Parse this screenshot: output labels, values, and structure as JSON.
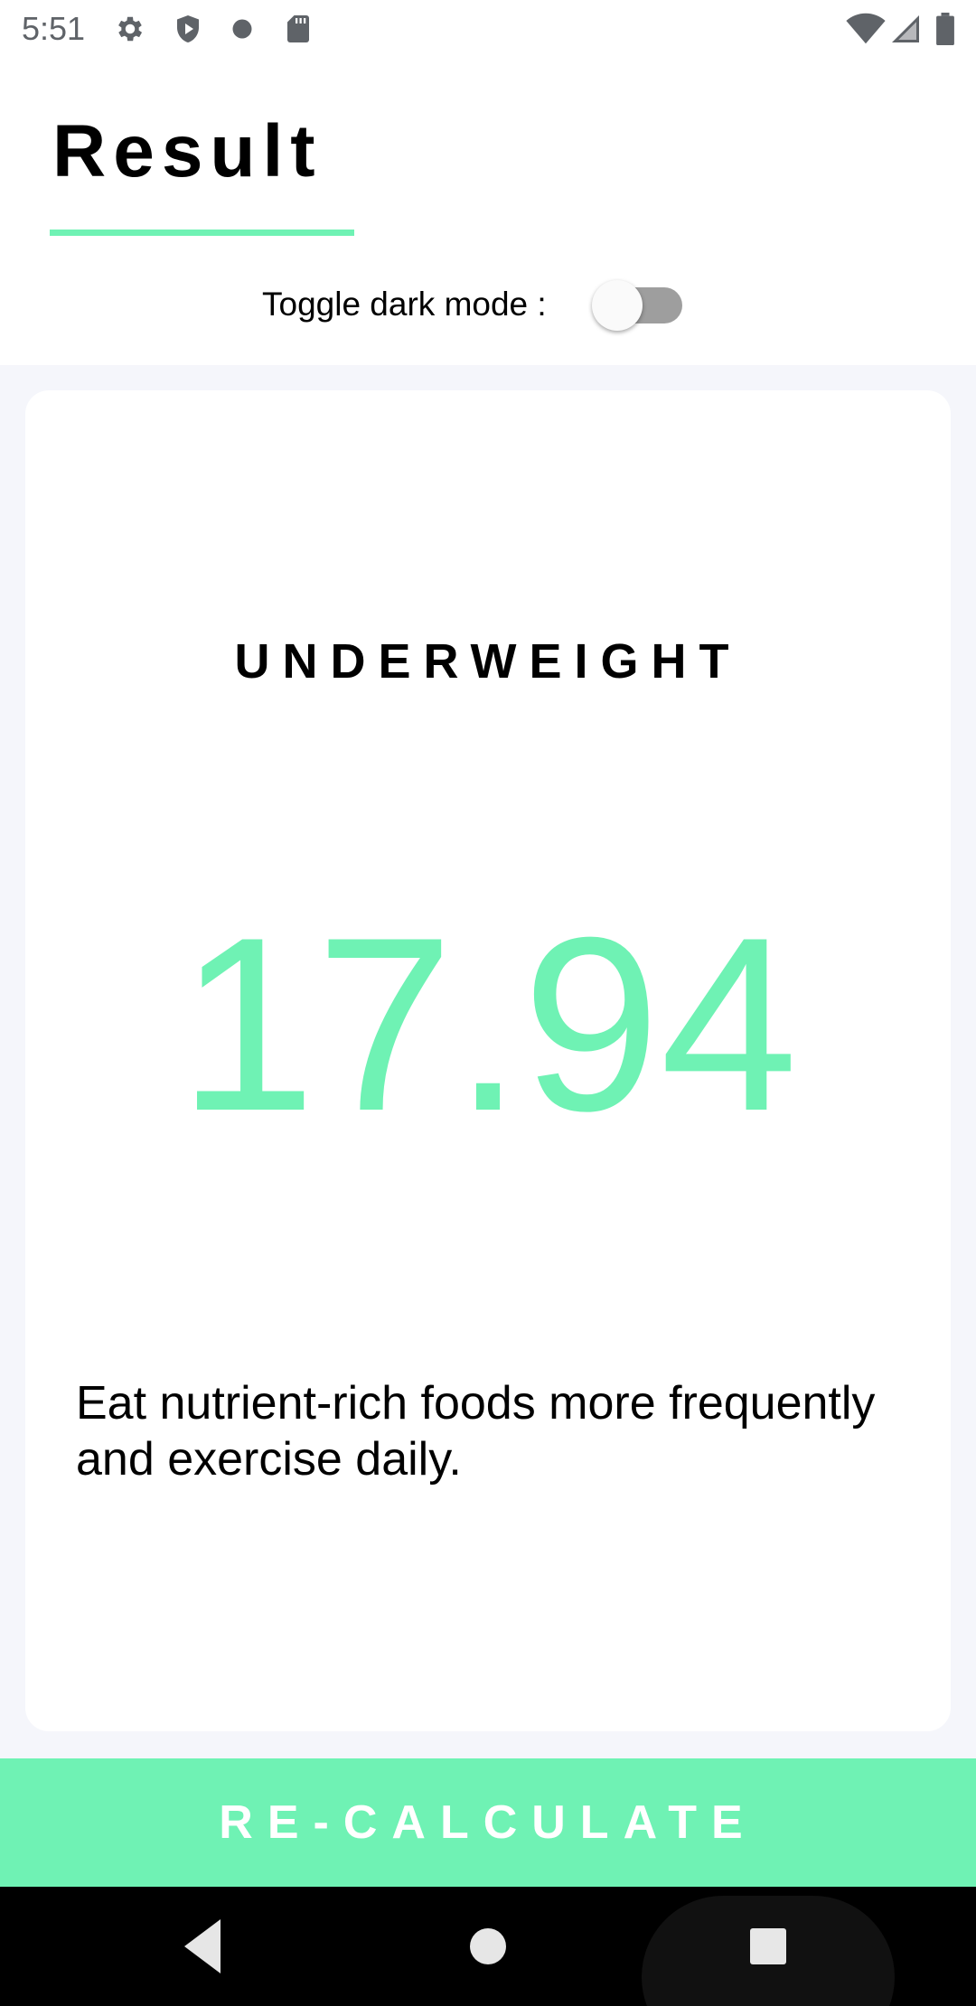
{
  "status_bar": {
    "time": "5:51",
    "left_icons": [
      "settings-icon",
      "shield-icon",
      "record-dot-icon",
      "sd-card-icon"
    ],
    "right_icons": [
      "wifi-icon",
      "cellular-signal-icon",
      "battery-icon"
    ]
  },
  "header": {
    "title": "Result",
    "dark_mode_label": "Toggle dark mode :",
    "dark_mode_enabled": false
  },
  "result": {
    "category": "UNDERWEIGHT",
    "bmi": "17.94",
    "advice": "Eat nutrient-rich foods more frequently and exercise daily."
  },
  "actions": {
    "recalculate_label": "RE-CALCULATE"
  },
  "nav_bar": {
    "buttons": [
      "back-icon",
      "home-icon",
      "recents-icon"
    ]
  },
  "colors": {
    "accent": "#6ff2b4",
    "content_background": "#f5f6fb",
    "card_background": "#ffffff",
    "toggle_track": "#9e9e9e",
    "nav_background": "#000000"
  }
}
